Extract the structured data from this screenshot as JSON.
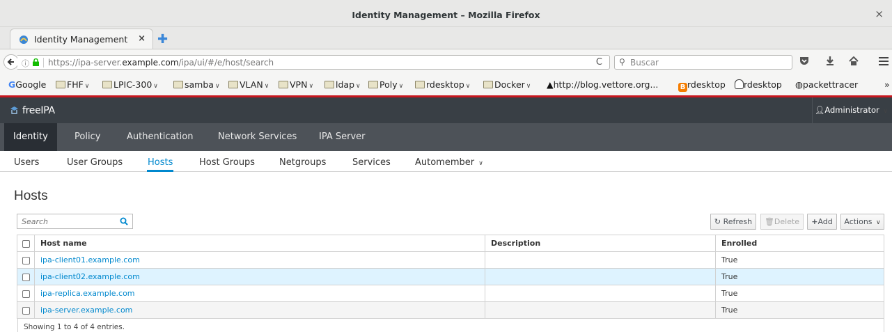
{
  "window": {
    "title": "Identity Management – Mozilla Firefox",
    "close": "×"
  },
  "browser": {
    "tab_label": "Identity Management",
    "tab_close": "×",
    "new_tab": "✚",
    "url_host_prefix": "https://ipa-server.",
    "url_host_domain": "example.com",
    "url_path": "/ipa/ui/#/e/host/search",
    "reload": "C",
    "search_placeholder": "Buscar",
    "bookmarks": [
      {
        "label": "Google",
        "type": "google"
      },
      {
        "label": "FHF",
        "type": "folder"
      },
      {
        "label": "LPIC-300",
        "type": "folder"
      },
      {
        "label": "samba",
        "type": "folder"
      },
      {
        "label": "VLAN",
        "type": "folder"
      },
      {
        "label": "VPN",
        "type": "folder"
      },
      {
        "label": "ldap",
        "type": "folder"
      },
      {
        "label": "Poly",
        "type": "folder"
      },
      {
        "label": "rdesktop",
        "type": "folder"
      },
      {
        "label": "Docker",
        "type": "folder"
      },
      {
        "label": "http://blog.vettore.org...",
        "type": "site"
      },
      {
        "label": "rdesktop",
        "type": "blogger"
      },
      {
        "label": "rdesktop",
        "type": "linux"
      },
      {
        "label": "packettracer",
        "type": "site2"
      }
    ],
    "overflow": "»"
  },
  "app": {
    "logo": "freeIPA",
    "user": "Administrator",
    "main_nav": [
      "Identity",
      "Policy",
      "Authentication",
      "Network Services",
      "IPA Server"
    ],
    "sub_nav": [
      "Users",
      "User Groups",
      "Hosts",
      "Host Groups",
      "Netgroups",
      "Services",
      "Automember"
    ],
    "active_sub": "Hosts"
  },
  "page": {
    "title": "Hosts",
    "search_placeholder": "Search",
    "buttons": {
      "refresh": "Refresh",
      "delete": "Delete",
      "add": "Add",
      "actions": "Actions"
    },
    "columns": [
      "Host name",
      "Description",
      "Enrolled"
    ],
    "rows": [
      {
        "host": "ipa-client01.example.com",
        "description": "",
        "enrolled": "True"
      },
      {
        "host": "ipa-client02.example.com",
        "description": "",
        "enrolled": "True"
      },
      {
        "host": "ipa-replica.example.com",
        "description": "",
        "enrolled": "True"
      },
      {
        "host": "ipa-server.example.com",
        "description": "",
        "enrolled": "True"
      }
    ],
    "footer": "Showing 1 to 4 of 4 entries."
  },
  "colors": {
    "accent": "#0088ce",
    "header": "#393f45",
    "nav": "#4d5258",
    "nav_active": "#292e34",
    "selected_row": "#def3ff"
  }
}
